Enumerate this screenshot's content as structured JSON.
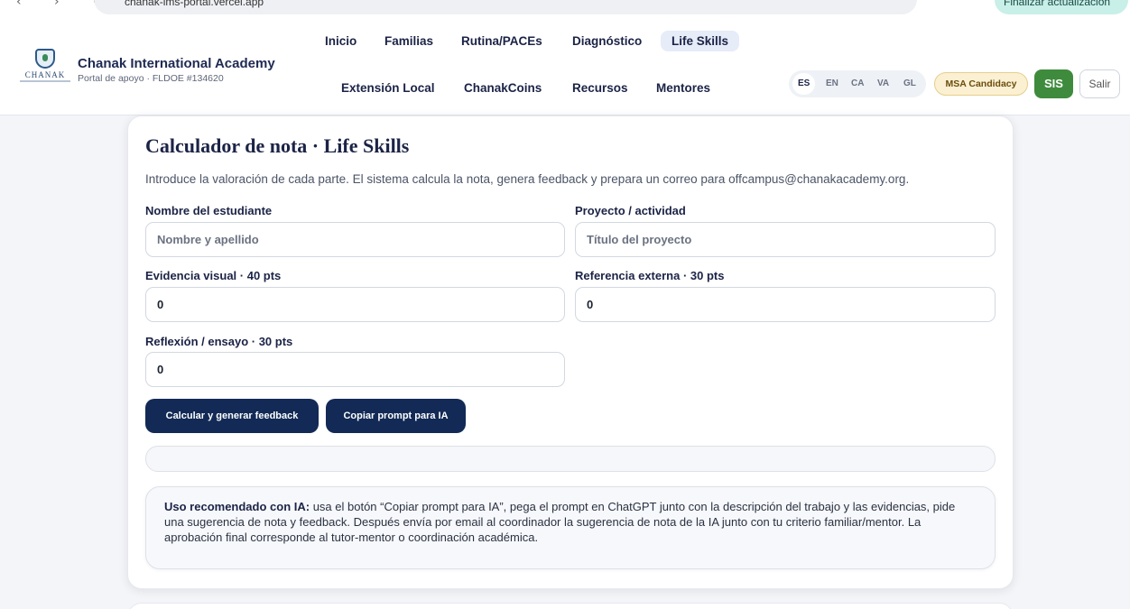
{
  "browser": {
    "url": "chanak-lms-portal.vercel.app",
    "update_button": "Finalizar actualización"
  },
  "brand": {
    "logo_text": "CHANAK",
    "name": "Chanak International Academy",
    "subtitle": "Portal de apoyo · FLDOE #134620"
  },
  "nav": {
    "inicio": "Inicio",
    "familias": "Familias",
    "rutina": "Rutina/PACEs",
    "diagnostico": "Diagnóstico",
    "life_skills": "Life Skills",
    "extension": "Extensión Local",
    "chanakcoins": "ChanakCoins",
    "recursos": "Recursos",
    "mentores": "Mentores"
  },
  "languages": [
    "ES",
    "EN",
    "CA",
    "VA",
    "GL"
  ],
  "active_language": "ES",
  "badges": {
    "msa": "MSA Candidacy"
  },
  "actions": {
    "sis": "SIS",
    "logout": "Salir"
  },
  "calculator": {
    "title": "Calculador de nota · Life Skills",
    "intro": "Introduce la valoración de cada parte. El sistema calcula la nota, genera feedback y prepara un correo para offcampus@chanakacademy.org.",
    "student_label": "Nombre del estudiante",
    "student_placeholder": "Nombre y apellido",
    "project_label": "Proyecto / actividad",
    "project_placeholder": "Título del proyecto",
    "visual_label": "Evidencia visual · 40 pts",
    "visual_value": "0",
    "external_label": "Referencia externa · 30 pts",
    "external_value": "0",
    "reflection_label": "Reflexión / ensayo · 30 pts",
    "reflection_value": "0",
    "calc_button": "Calcular y generar feedback",
    "copy_button": "Copiar prompt para IA",
    "tip_strong": "Uso recomendado con IA:",
    "tip_text": " usa el botón “Copiar prompt para IA”, pega el prompt en ChatGPT junto con la descripción del trabajo y las evidencias, pide una sugerencia de nota y feedback. Después envía por email al coordinador la sugerencia de nota de la IA junto con tu criterio familiar/mentor. La aprobación final corresponde al tutor-mentor o coordinación académica."
  },
  "colors": {
    "primary": "#122a55",
    "sis_green": "#3f8b3d",
    "active_tab": "#e6ecf8",
    "badge_bg": "#fbf0d2"
  }
}
